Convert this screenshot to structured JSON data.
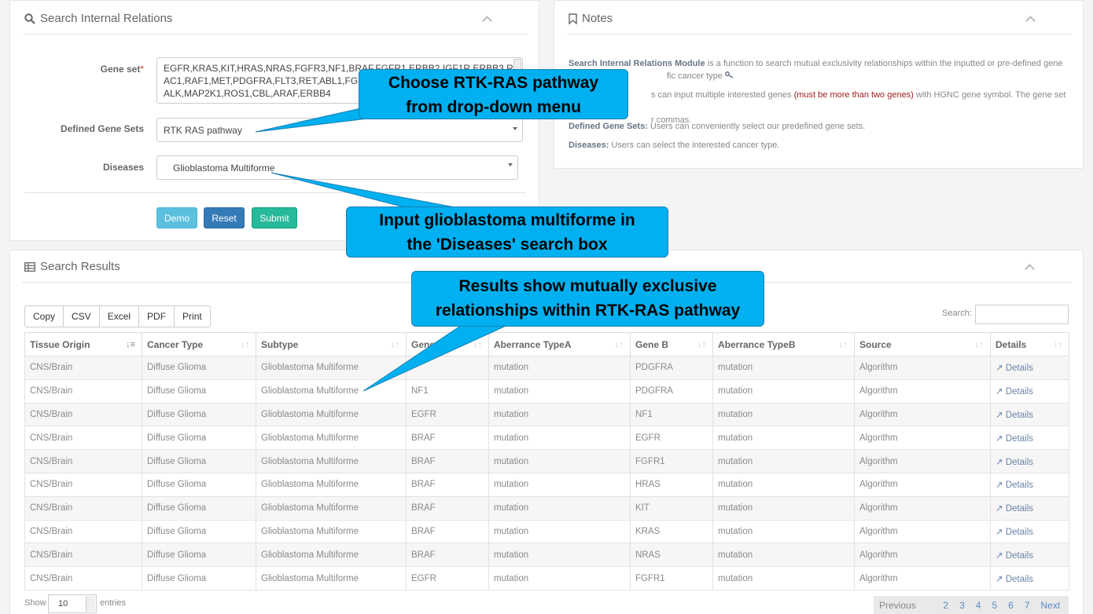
{
  "search_panel": {
    "title": "Search Internal Relations",
    "gene_set_label": "Gene set",
    "gene_set_required": "*",
    "gene_set_lines": [
      "EGFR,KRAS,KIT,HRAS,NRAS,FGFR3,NF1,BRAF,FGFR1,ERBB2,IGF1R,ERBB3,R",
      "AC1,RAF1,MET,PDGFRA,FLT3,RET,ABL1,FGF",
      "ALK,MAP2K1,ROS1,CBL,ARAF,ERBB4"
    ],
    "defined_label": "Defined Gene Sets",
    "defined_value": "RTK RAS pathway",
    "diseases_label": "Diseases",
    "diseases_value": "Glioblastoma Multiforme",
    "demo": "Demo",
    "reset": "Reset",
    "submit": "Submit"
  },
  "notes_panel": {
    "title": "Notes",
    "p1_bold": "Search Internal Relations Module",
    "p1_text": " is a function to search mutual exclusivity relationships within the inputted or pre-defined gene",
    "p1_line2": "fic cancer type",
    "p2_text": "s can input multiple interested genes ",
    "p2_red": "(must be more than two genes)",
    "p2_after": " with HGNC gene symbol. The gene set should",
    "p2_line2": "r commas.",
    "p3_bold": "Defined Gene Sets:",
    "p3_text": " Users can conveniently select our predefined gene sets.",
    "p4_bold": "Diseases:",
    "p4_text": " Users can select the interested cancer type."
  },
  "results_panel": {
    "title": "Search Results",
    "buttons": [
      "Copy",
      "CSV",
      "Excel",
      "PDF",
      "Print"
    ],
    "search_label": "Search:",
    "columns": [
      "Tissue Origin",
      "Cancer Type",
      "Subtype",
      "Gene A",
      "Aberrance TypeA",
      "Gene B",
      "Aberrance TypeB",
      "Source",
      "Details"
    ],
    "rows": [
      [
        "CNS/Brain",
        "Diffuse Glioma",
        "Glioblastoma Multiforme",
        "",
        "mutation",
        "PDGFRA",
        "mutation",
        "Algorithm",
        "Details"
      ],
      [
        "CNS/Brain",
        "Diffuse Glioma",
        "Glioblastoma Multiforme",
        "NF1",
        "mutation",
        "PDGFRA",
        "mutation",
        "Algorithm",
        "Details"
      ],
      [
        "CNS/Brain",
        "Diffuse Glioma",
        "Glioblastoma Multiforme",
        "EGFR",
        "mutation",
        "NF1",
        "mutation",
        "Algorithm",
        "Details"
      ],
      [
        "CNS/Brain",
        "Diffuse Glioma",
        "Glioblastoma Multiforme",
        "BRAF",
        "mutation",
        "EGFR",
        "mutation",
        "Algorithm",
        "Details"
      ],
      [
        "CNS/Brain",
        "Diffuse Glioma",
        "Glioblastoma Multiforme",
        "BRAF",
        "mutation",
        "FGFR1",
        "mutation",
        "Algorithm",
        "Details"
      ],
      [
        "CNS/Brain",
        "Diffuse Glioma",
        "Glioblastoma Multiforme",
        "BRAF",
        "mutation",
        "HRAS",
        "mutation",
        "Algorithm",
        "Details"
      ],
      [
        "CNS/Brain",
        "Diffuse Glioma",
        "Glioblastoma Multiforme",
        "BRAF",
        "mutation",
        "KIT",
        "mutation",
        "Algorithm",
        "Details"
      ],
      [
        "CNS/Brain",
        "Diffuse Glioma",
        "Glioblastoma Multiforme",
        "BRAF",
        "mutation",
        "KRAS",
        "mutation",
        "Algorithm",
        "Details"
      ],
      [
        "CNS/Brain",
        "Diffuse Glioma",
        "Glioblastoma Multiforme",
        "BRAF",
        "mutation",
        "NRAS",
        "mutation",
        "Algorithm",
        "Details"
      ],
      [
        "CNS/Brain",
        "Diffuse Glioma",
        "Glioblastoma Multiforme",
        "EGFR",
        "mutation",
        "FGFR1",
        "mutation",
        "Algorithm",
        "Details"
      ]
    ],
    "show_label": "Show",
    "show_value": "10",
    "entries_label": "entries",
    "pager": [
      "Previous",
      "1",
      "2",
      "3",
      "4",
      "5",
      "6",
      "7",
      "Next"
    ]
  },
  "callouts": {
    "c1_line1": "Choose RTK-RAS pathway",
    "c1_line2": "from drop-down menu",
    "c2_line1": "Input glioblastoma multiforme in",
    "c2_line2": "the 'Diseases' search box",
    "c3_line1": "Results show mutually exclusive",
    "c3_line2": "relationships within RTK-RAS pathway"
  },
  "colors": {
    "callout": "#00b0f0",
    "demo": "#5bc0de",
    "reset": "#337ab7",
    "submit": "#26b99a"
  }
}
